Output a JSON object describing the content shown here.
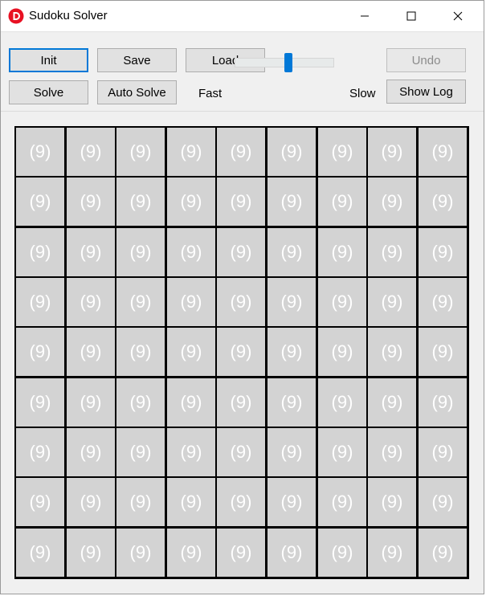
{
  "window": {
    "title": "Sudoku Solver",
    "icon": "letter-d-app-icon"
  },
  "titlebar_buttons": {
    "minimize": "minimize-icon",
    "maximize": "maximize-icon",
    "close": "close-icon"
  },
  "toolbar": {
    "init_label": "Init",
    "save_label": "Save",
    "load_label": "Load",
    "undo_label": "Undo",
    "solve_label": "Solve",
    "auto_solve_label": "Auto Solve",
    "fast_label": "Fast",
    "slow_label": "Slow",
    "show_log_label": "Show Log"
  },
  "speed_slider": {
    "value": 0.5
  },
  "colors": {
    "accent": "#0078d7",
    "cell_background": "#d3d3d3",
    "cell_text": "#ffffff",
    "grid_lines": "#000000"
  },
  "board": {
    "rows": [
      [
        "(9)",
        "(9)",
        "(9)",
        "(9)",
        "(9)",
        "(9)",
        "(9)",
        "(9)",
        "(9)"
      ],
      [
        "(9)",
        "(9)",
        "(9)",
        "(9)",
        "(9)",
        "(9)",
        "(9)",
        "(9)",
        "(9)"
      ],
      [
        "(9)",
        "(9)",
        "(9)",
        "(9)",
        "(9)",
        "(9)",
        "(9)",
        "(9)",
        "(9)"
      ],
      [
        "(9)",
        "(9)",
        "(9)",
        "(9)",
        "(9)",
        "(9)",
        "(9)",
        "(9)",
        "(9)"
      ],
      [
        "(9)",
        "(9)",
        "(9)",
        "(9)",
        "(9)",
        "(9)",
        "(9)",
        "(9)",
        "(9)"
      ],
      [
        "(9)",
        "(9)",
        "(9)",
        "(9)",
        "(9)",
        "(9)",
        "(9)",
        "(9)",
        "(9)"
      ],
      [
        "(9)",
        "(9)",
        "(9)",
        "(9)",
        "(9)",
        "(9)",
        "(9)",
        "(9)",
        "(9)"
      ],
      [
        "(9)",
        "(9)",
        "(9)",
        "(9)",
        "(9)",
        "(9)",
        "(9)",
        "(9)",
        "(9)"
      ],
      [
        "(9)",
        "(9)",
        "(9)",
        "(9)",
        "(9)",
        "(9)",
        "(9)",
        "(9)",
        "(9)"
      ]
    ]
  }
}
